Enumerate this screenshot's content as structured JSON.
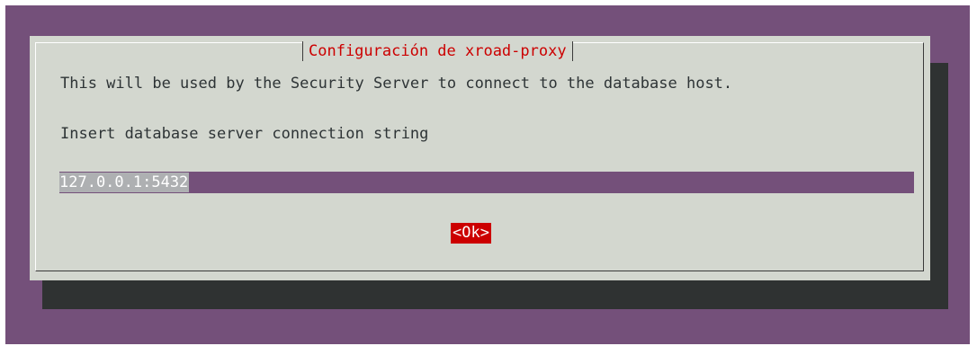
{
  "dialog": {
    "title": "Configuración de xroad-proxy",
    "description": "This will be used by the Security Server to connect to the database host.",
    "prompt": "Insert database server connection string",
    "input_value": "127.0.0.1:5432",
    "ok_label": "<Ok>"
  },
  "colors": {
    "terminal_background": "#74507a",
    "dialog_background": "#d3d7cf",
    "title_text": "#cc0000",
    "selected_button": "#cc0000",
    "shadow": "#2f3232"
  }
}
